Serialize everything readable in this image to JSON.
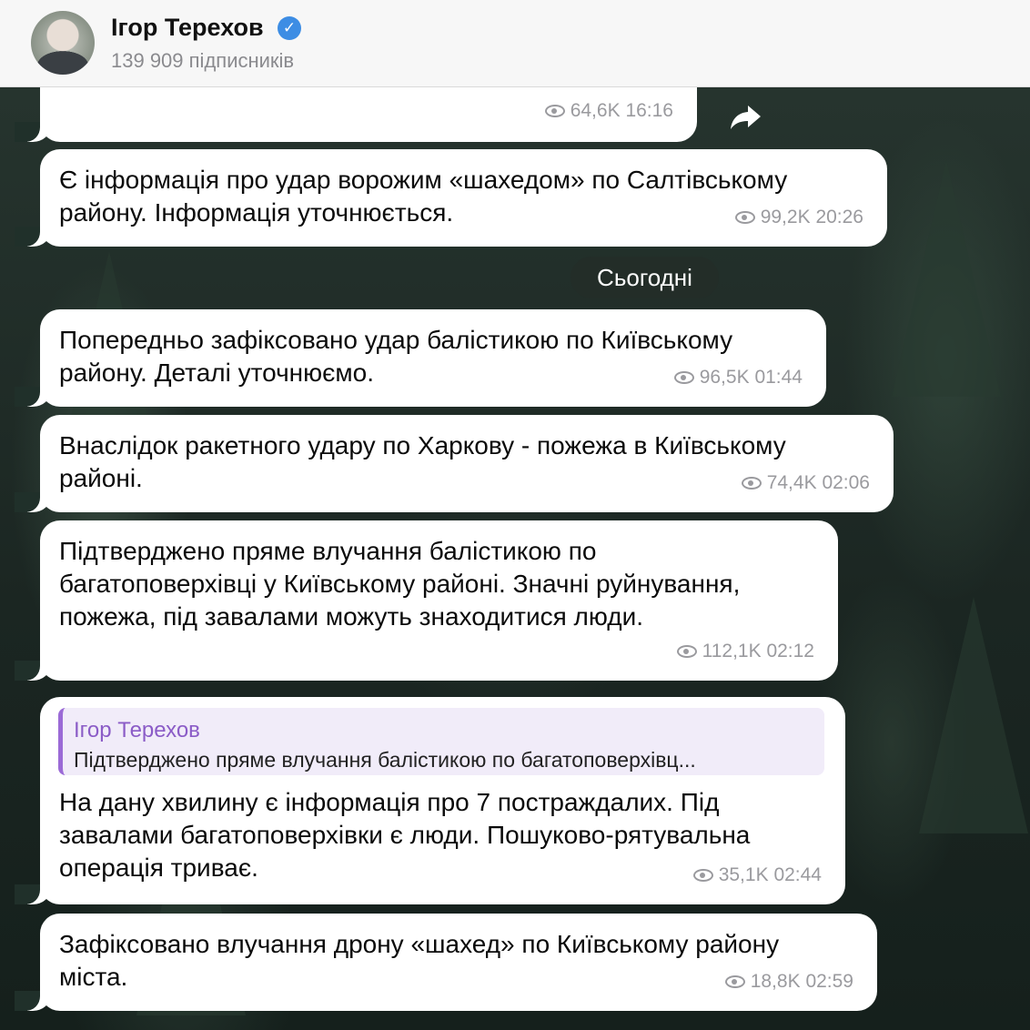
{
  "channel": {
    "name": "Ігор Терехов",
    "subscribers": "139 909 підписників"
  },
  "messages": [
    {
      "lines": [],
      "views": "64,6K",
      "time": "16:16"
    },
    {
      "lines": [
        "Є інформація про удар ворожим «шахедом» по Салтівському",
        "району. Інформація уточнюється."
      ],
      "views": "99,2K",
      "time": "20:26"
    },
    {
      "lines": [
        "Попередньо зафіксовано удар балістикою по Київському",
        "району. Деталі уточнюємо."
      ],
      "views": "96,5K",
      "time": "01:44"
    },
    {
      "lines": [
        "Внаслідок ракетного удару по Харкову - пожежа в Київському",
        "районі."
      ],
      "views": "74,4K",
      "time": "02:06"
    },
    {
      "lines": [
        "Підтверджено пряме влучання балістикою по",
        "багатоповерхівці у Київському районі. Значні руйнування,",
        "пожежа, під завалами можуть знаходитися люди."
      ],
      "views": "112,1K",
      "time": "02:12"
    },
    {
      "reply": {
        "author": "Ігор Терехов",
        "text": "Підтверджено пряме влучання балістикою по багатоповерхівц..."
      },
      "lines": [
        "На дану хвилину є інформація про 7 постраждалих. Під",
        "завалами багатоповерхівки є люди. Пошуково-рятувальна",
        "операція триває."
      ],
      "views": "35,1K",
      "time": "02:44"
    },
    {
      "lines": [
        "Зафіксовано влучання дрону «шахед» по Київському району",
        "міста."
      ],
      "views": "18,8K",
      "time": "02:59"
    }
  ],
  "date_separator": "Сьогодні",
  "icons": {
    "verified": "verified-check-icon",
    "views": "eye-icon",
    "share": "share-arrow-icon"
  },
  "colors": {
    "verified": "#3d8de4",
    "reply_accent": "#9b6ad6",
    "meta_gray": "#9a9a9e"
  }
}
